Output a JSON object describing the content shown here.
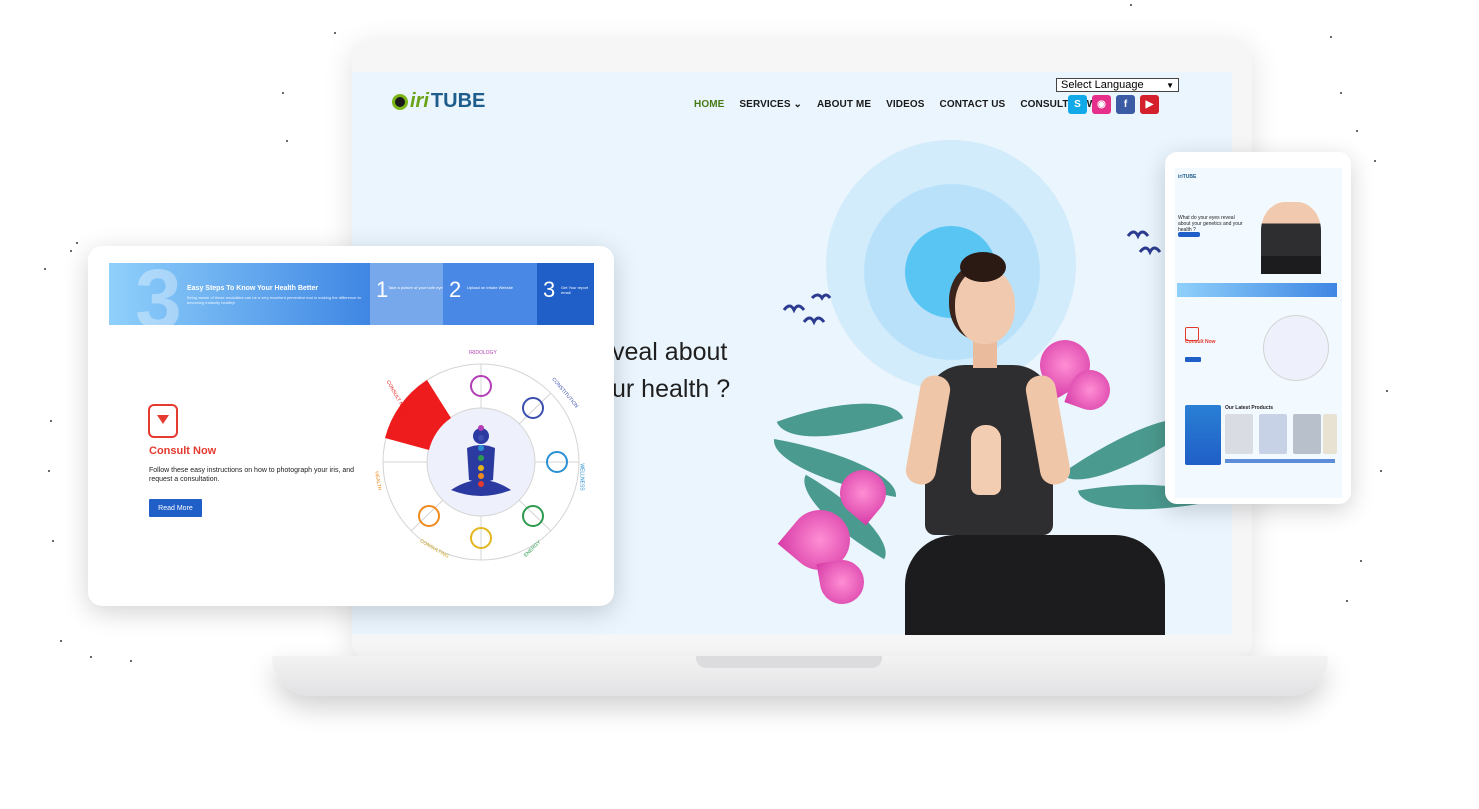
{
  "laptop": {
    "logo": {
      "iri": "iri",
      "tube": "TUBE"
    },
    "nav": {
      "home": "HOME",
      "services": "SERVICES",
      "about": "ABOUT ME",
      "videos": "VIDEOS",
      "contact": "CONTACT US",
      "consult": "CONSULT NOW"
    },
    "language_select": "Select Language",
    "social_icons": [
      "skype-icon",
      "instagram-icon",
      "facebook-icon",
      "youtube-icon"
    ],
    "hero": {
      "line1": "veal about",
      "line2": "ur health ?"
    }
  },
  "tablet": {
    "banner": {
      "big_number": "3",
      "title": "Easy Steps To Know Your Health Better",
      "description": "Being aware of these modalities can be a very excellent preventive tool in making the difference to becoming instantly healthy!",
      "steps": [
        {
          "number": "1",
          "label": "Take a picture of your both eyes"
        },
        {
          "number": "2",
          "label": "Upload on Iritube Website"
        },
        {
          "number": "3",
          "label": "Get Your report email"
        }
      ]
    },
    "consult_title": "Consult Now",
    "consult_description": "Follow these easy instructions on how to photograph your iris, and request a consultation.",
    "read_more": "Read More",
    "wheel_labels": [
      "IRIDOLOGY",
      "CONSTITUTION",
      "WELLNESS",
      "ENERGY",
      "CONSULTING",
      "HEALTH",
      "CONSULT NOW"
    ]
  },
  "phone": {
    "logo": "iriTUBE",
    "hero_text": "What do your eyes reveal about your genetics and your health ?",
    "consult_title": "Consult Now",
    "products_title": "Our Latest Products"
  },
  "colors": {
    "accent_red": "#e43a2f",
    "accent_blue": "#1f5fc7",
    "brand_green": "#6aa317"
  }
}
